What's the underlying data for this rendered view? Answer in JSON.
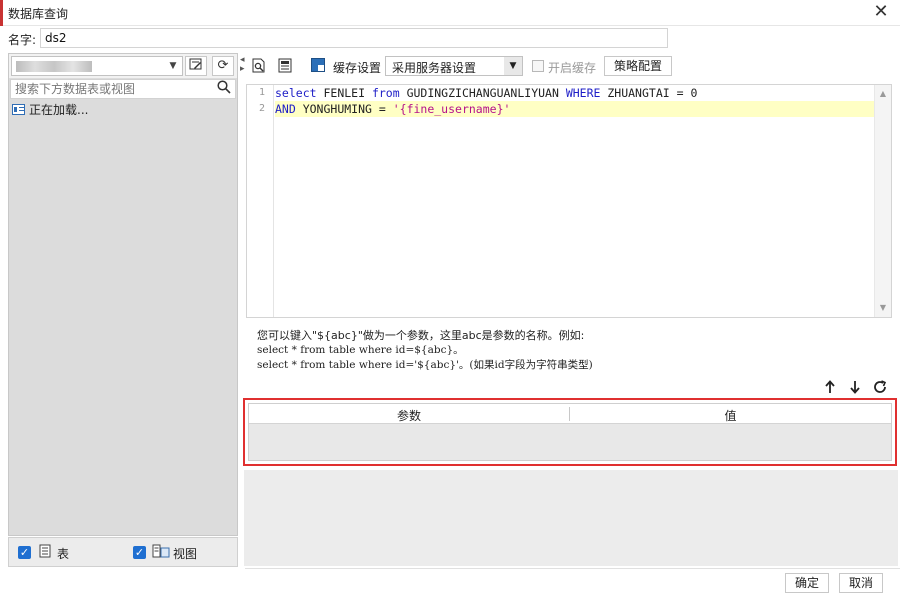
{
  "window": {
    "title": "数据库查询",
    "close_glyph": "✕"
  },
  "name_field": {
    "label": "名字:",
    "value": "ds2"
  },
  "left_panel": {
    "search_placeholder": "搜索下方数据表或视图",
    "tree_items": [
      "正在加载..."
    ],
    "bottom": {
      "table_label": "表",
      "view_label": "视图"
    }
  },
  "sql_toolbar": {
    "cache_settings_label": "缓存设置",
    "server_setting_value": "采用服务器设置",
    "enable_cache_label": "开启缓存",
    "policy_button_label": "策略配置"
  },
  "editor": {
    "line_numbers": [
      "1",
      "2"
    ],
    "line1": {
      "k1": "select",
      "t1": " FENLEI ",
      "k2": "from",
      "t2": " GUDINGZICHANGUANLIYUAN ",
      "k3": "WHERE",
      "t3": " ZHUANGTAI = 0"
    },
    "line2": {
      "k1": "AND",
      "t1": " YONGHUMING = ",
      "s1": "'{fine_username}'"
    }
  },
  "hint": {
    "line1": "您可以键入\"${abc}\"做为一个参数，这里abc是参数的名称。例如:",
    "line2": "select * from table where id=${abc}。",
    "line3": "select * from table where id='${abc}'。(如果id字段为字符串类型)"
  },
  "params_table": {
    "col_param": "参数",
    "col_value": "值"
  },
  "footer": {
    "ok_label": "确定",
    "cancel_label": "取消"
  },
  "colors": {
    "highlight_border": "#e03030",
    "keyword": "#1d1dc7",
    "string": "#b5128a",
    "checkbox": "#1f6fd1"
  }
}
